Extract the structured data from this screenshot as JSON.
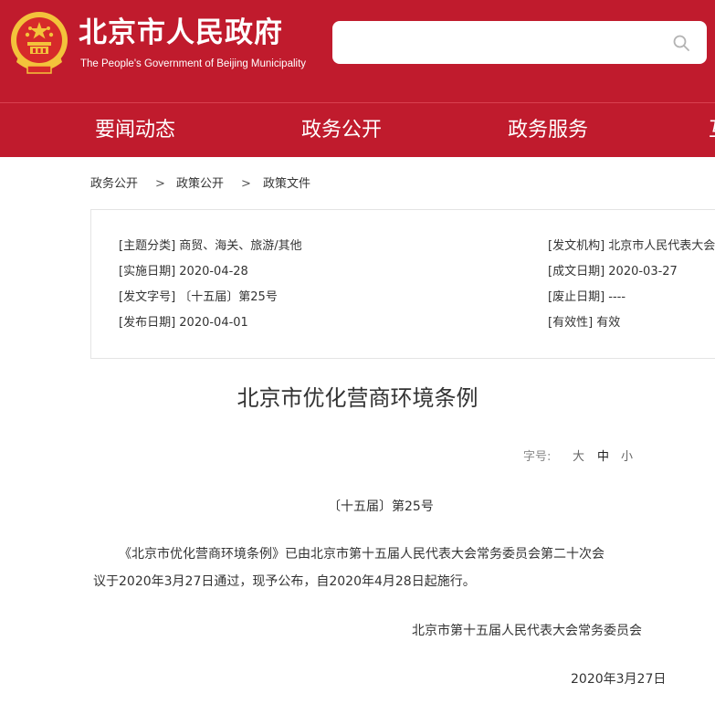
{
  "header": {
    "title": "北京市人民政府",
    "subtitle": "The People's Government of Beijing Municipality",
    "search": {
      "placeholder": "",
      "icon": "search-icon"
    }
  },
  "nav": {
    "items": [
      "要闻动态",
      "政务公开",
      "政务服务",
      "互"
    ]
  },
  "breadcrumb": {
    "items": [
      "政务公开",
      "政策公开",
      "政策文件"
    ],
    "separator": ">"
  },
  "info": {
    "topic": "[主题分类] 商贸、海关、旅游/其他",
    "effective_date": "[实施日期] 2020-04-28",
    "doc_number": "[发文字号] 〔十五届〕第25号",
    "publish_date": "[发布日期] 2020-04-01",
    "issuer": "[发文机构] 北京市人民代表大会常务委员会",
    "written_date": "[成文日期] 2020-03-27",
    "repeal_date": "[废止日期] ----",
    "validity": "[有效性] 有效"
  },
  "document": {
    "title": "北京市优化营商环境条例",
    "font_size_label": "字号:",
    "font_sizes": [
      "大",
      "中",
      "小"
    ],
    "number": "〔十五届〕第25号",
    "paragraph_line1": "《北京市优化营商环境条例》已由北京市第十五届人民代表大会常务委员会第二十次会",
    "paragraph_line2": "议于2020年3月27日通过，现予公布，自2020年4月28日起施行。",
    "signature": "北京市第十五届人民代表大会常务委员会",
    "date": "2020年3月27日"
  },
  "colors": {
    "brand_red": "#c01b2d",
    "emblem_gold": "#f3c33b"
  }
}
